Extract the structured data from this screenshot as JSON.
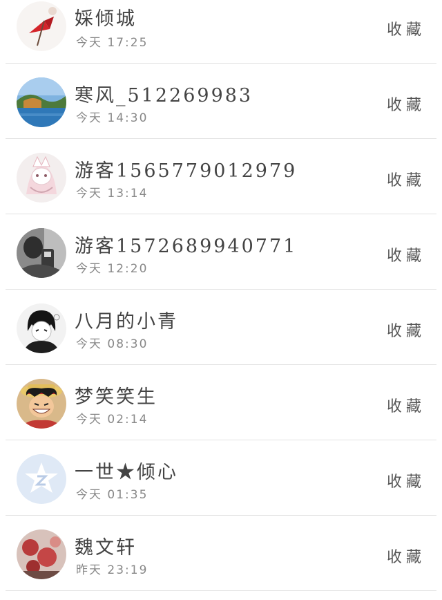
{
  "list": {
    "items": [
      {
        "name": "婇倾城",
        "time": "今天 17:25",
        "action": "收藏",
        "avatar": "red-umbrella-avatar"
      },
      {
        "name": "寒风_512269983",
        "time": "今天 14:30",
        "action": "收藏",
        "avatar": "lake-landscape-avatar"
      },
      {
        "name": "游客1565779012979",
        "time": "今天 13:14",
        "action": "收藏",
        "avatar": "fox-mask-girl-avatar"
      },
      {
        "name": "游客1572689940771",
        "time": "今天 12:20",
        "action": "收藏",
        "avatar": "monochrome-photo-avatar"
      },
      {
        "name": "八月的小青",
        "time": "今天 08:30",
        "action": "收藏",
        "avatar": "anime-boy-avatar"
      },
      {
        "name": "梦笑笑生",
        "time": "今天 02:14",
        "action": "收藏",
        "avatar": "straw-hat-anime-avatar"
      },
      {
        "name": "一世★倾心",
        "time": "今天 01:35",
        "action": "收藏",
        "avatar": "qzone-default-avatar"
      },
      {
        "name": "魏文轩",
        "time": "昨天 23:19",
        "action": "收藏",
        "avatar": "red-flowers-avatar"
      }
    ]
  }
}
